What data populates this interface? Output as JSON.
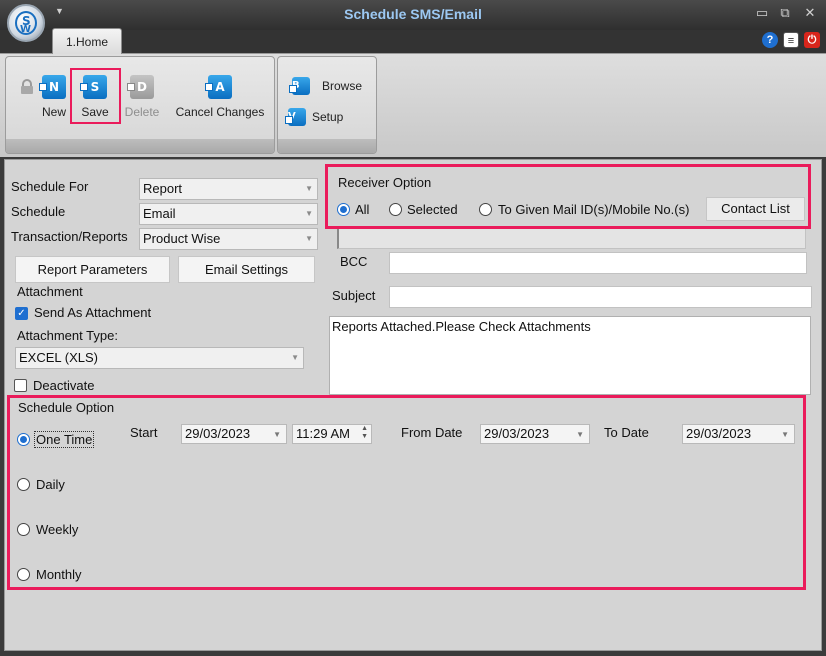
{
  "window": {
    "title": "Schedule SMS/Email",
    "minimize": "▭",
    "restore": "⧉",
    "close": "✕"
  },
  "tabs": [
    {
      "label": "1.Home"
    }
  ],
  "ribbon": {
    "new_label": "New",
    "save_label": "Save",
    "delete_label": "Delete",
    "cancel_label": "Cancel Changes",
    "browse_label": "Browse",
    "setup_label": "Setup",
    "icon_new": "N",
    "icon_save": "S",
    "icon_delete": "D",
    "icon_cancel": "A",
    "icon_browse": "B",
    "icon_setup": "V"
  },
  "form": {
    "schedule_for_label": "Schedule For",
    "schedule_for_value": "Report",
    "schedule_label": "Schedule",
    "schedule_value": "Email",
    "transaction_label": "Transaction/Reports",
    "transaction_value": "Product Wise",
    "report_params_button": "Report Parameters",
    "email_settings_button": "Email Settings",
    "attachment_group": "Attachment",
    "send_as_attachment": "Send As Attachment",
    "attachment_type_label": "Attachment Type:",
    "attachment_type_value": "EXCEL (XLS)",
    "deactivate": "Deactivate"
  },
  "receiver": {
    "title": "Receiver Option",
    "options": [
      "All",
      "Selected",
      "To Given Mail ID(s)/Mobile No.(s)"
    ],
    "selected": "All",
    "contact_list_button": "Contact List",
    "bcc_label": "BCC",
    "subject_label": "Subject",
    "message": "Reports Attached.Please Check Attachments"
  },
  "schedule_option": {
    "title": "Schedule Option",
    "options": [
      "One Time",
      "Daily",
      "Weekly",
      "Monthly"
    ],
    "selected": "One Time",
    "start_label": "Start",
    "start_date": "29/03/2023",
    "start_time": "11:29 AM",
    "from_date_label": "From Date",
    "from_date": "29/03/2023",
    "to_date_label": "To Date",
    "to_date": "29/03/2023"
  },
  "colors": {
    "highlight": "#ea1b5b",
    "accent": "#1f6fd0",
    "title_text": "#9cc8f2"
  }
}
